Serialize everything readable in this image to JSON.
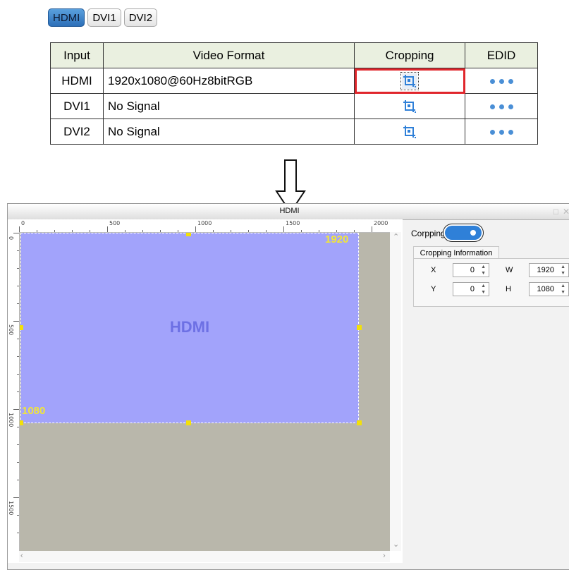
{
  "tabs": [
    {
      "label": "HDMI",
      "active": true
    },
    {
      "label": "DVI1",
      "active": false
    },
    {
      "label": "DVI2",
      "active": false
    }
  ],
  "table": {
    "headers": [
      "Input",
      "Video Format",
      "Cropping",
      "EDID"
    ],
    "rows": [
      {
        "input": "HDMI",
        "format": "1920x1080@60Hz8bitRGB"
      },
      {
        "input": "DVI1",
        "format": "No Signal"
      },
      {
        "input": "DVI2",
        "format": "No Signal"
      }
    ],
    "icons": {
      "cropping": "crop-icon",
      "edid": "more-dots-icon"
    }
  },
  "window": {
    "title": "HDMI",
    "canvas": {
      "source_label": "HDMI",
      "width_label": "1920",
      "height_label": "1080",
      "ruler_top": [
        "0",
        "500",
        "1000",
        "1500",
        "2000"
      ],
      "ruler_left": [
        "0",
        "500",
        "1000",
        "1500"
      ]
    }
  },
  "panel": {
    "cropping_label": "Corpping",
    "cropping_enabled": true,
    "info_tab": "Cropping Information",
    "fields": {
      "x_label": "X",
      "x_value": "0",
      "y_label": "Y",
      "y_value": "0",
      "w_label": "W",
      "w_value": "1920",
      "h_label": "H",
      "h_value": "1080"
    }
  },
  "colors": {
    "accent": "#2f80d8",
    "highlight": "#e0262c",
    "source_fill": "#a2a3fb",
    "canvas_bg": "#b9b7ab",
    "marker": "#f2e00a"
  }
}
